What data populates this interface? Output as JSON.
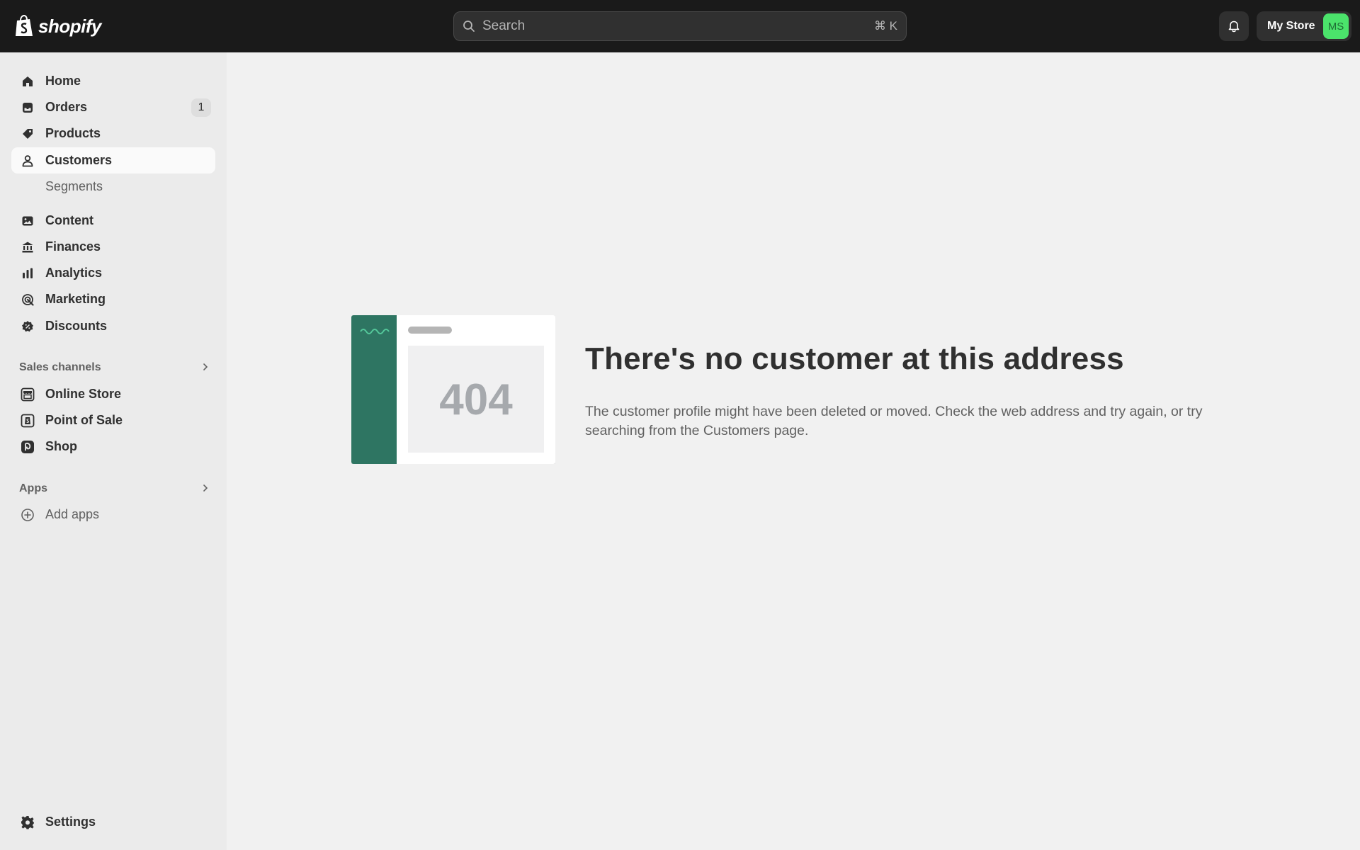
{
  "app": {
    "logo_text": "shopify",
    "search_placeholder": "Search",
    "search_shortcut": "⌘ K",
    "store_name": "My Store",
    "avatar_initials": "MS",
    "accent_avatar": "#4be36b"
  },
  "sidebar": {
    "main_items": [
      {
        "label": "Home",
        "icon": "home-icon"
      },
      {
        "label": "Orders",
        "icon": "inbox-icon",
        "badge": "1"
      },
      {
        "label": "Products",
        "icon": "tag-icon"
      },
      {
        "label": "Customers",
        "icon": "person-icon",
        "active": true
      },
      {
        "label": "Segments",
        "sub": true
      }
    ],
    "secondary_items": [
      {
        "label": "Content",
        "icon": "image-icon"
      },
      {
        "label": "Finances",
        "icon": "bank-icon"
      },
      {
        "label": "Analytics",
        "icon": "bar-chart-icon"
      },
      {
        "label": "Marketing",
        "icon": "target-icon"
      },
      {
        "label": "Discounts",
        "icon": "discount-icon"
      }
    ],
    "sales_channels_title": "Sales channels",
    "sales_channels": [
      {
        "label": "Online Store",
        "icon": "store-icon"
      },
      {
        "label": "Point of Sale",
        "icon": "pos-icon"
      },
      {
        "label": "Shop",
        "icon": "shop-icon"
      }
    ],
    "apps_title": "Apps",
    "add_apps_label": "Add apps",
    "settings_label": "Settings"
  },
  "main": {
    "illustration_code": "404",
    "title": "There's no customer at this address",
    "description": "The customer profile might have been deleted or moved. Check the web address and try again, or try searching from the Customers page."
  }
}
